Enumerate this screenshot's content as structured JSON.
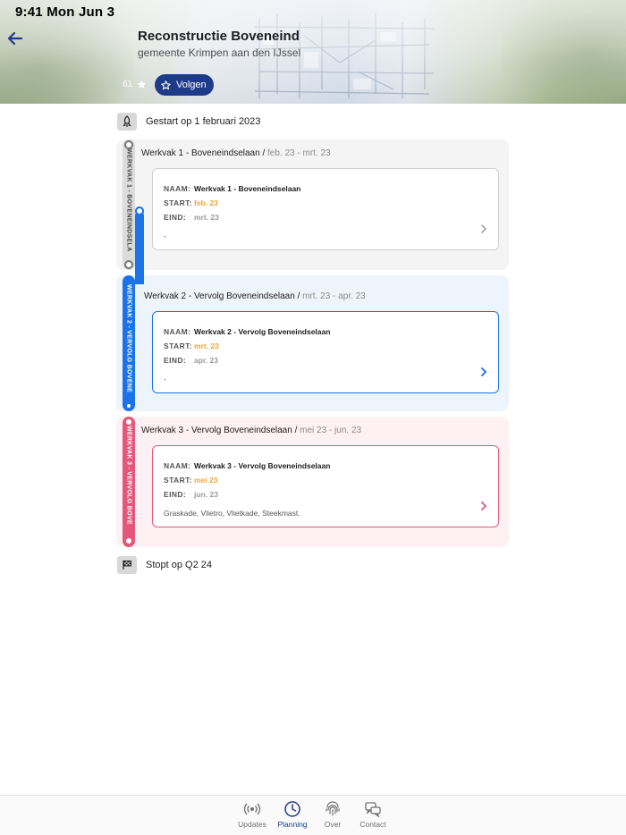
{
  "status": {
    "time": "9:41  Mon Jun 3"
  },
  "header": {
    "title": "Reconstructie Boveneind",
    "subtitle": "gemeente Krimpen aan den IJssel",
    "follower_count": "61",
    "follow_label": "Volgen"
  },
  "start_milestone": {
    "label": "Gestart op 1 februari 2023"
  },
  "end_milestone": {
    "label": "Stopt op Q2 24"
  },
  "phases": [
    {
      "rail_label": "WERKVAK 1 - BOVENEINDSELA",
      "head_name": "Werkvak 1 - Boveneindselaan /",
      "head_range": "feb. 23 - mrt. 23",
      "name_label": "NAAM:",
      "name": "Werkvak 1 - Boveneindselaan",
      "start_label": "START:",
      "start": "feb. 23",
      "end_label": "EIND:",
      "end": "mrt. 23",
      "description": "-",
      "color": "#7a7a7a"
    },
    {
      "rail_label": "WERKVAK 2 - VERVOLG BOVENE",
      "head_name": "Werkvak 2 - Vervolg Boveneindselaan /",
      "head_range": "mrt. 23 - apr. 23",
      "name_label": "NAAM:",
      "name": "Werkvak 2 - Vervolg Boveneindselaan",
      "start_label": "START:",
      "start": "mrt. 23",
      "end_label": "EIND:",
      "end": "apr. 23",
      "description": "-",
      "color": "#1a73e8"
    },
    {
      "rail_label": "WERKVAK 3 - VERVOLG BOVE",
      "head_name": "Werkvak 3 - Vervolg Boveneindselaan /",
      "head_range": "mei 23 - jun. 23",
      "name_label": "NAAM:",
      "name": "Werkvak 3 - Vervolg Boveneindselaan",
      "start_label": "START:",
      "start": "mei 23",
      "end_label": "EIND:",
      "end": "jun. 23",
      "description": "Graskade, Vlietro, Vlietkade, Steekmast.",
      "color": "#e5577a"
    }
  ],
  "tabs": [
    {
      "label": "Updates",
      "icon": "broadcast-icon"
    },
    {
      "label": "Planning",
      "icon": "clock-icon"
    },
    {
      "label": "Over",
      "icon": "fingerprint-icon"
    },
    {
      "label": "Contact",
      "icon": "chat-icon"
    }
  ],
  "colors": {
    "accent": "#1e3b8a",
    "orange": "#f0a530",
    "phase1": "#7a7a7a",
    "phase2": "#1a73e8",
    "phase3": "#e5577a"
  }
}
